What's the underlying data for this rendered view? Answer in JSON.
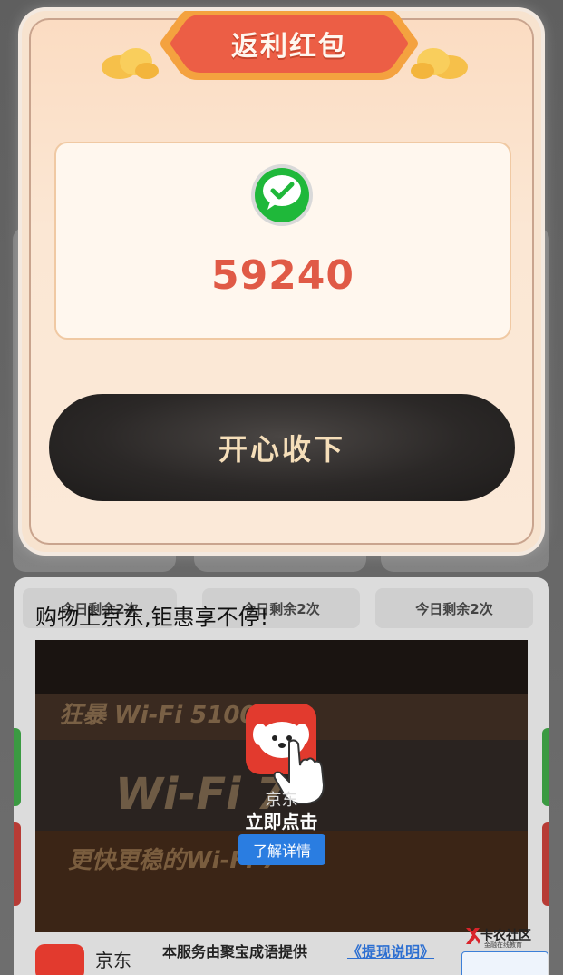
{
  "modal": {
    "title": "返利红包",
    "amount": "59240",
    "accept_label": "开心收下"
  },
  "ad": {
    "chips": [
      "今日剩余2次",
      "今日剩余2次",
      "今日剩余2次"
    ],
    "slogan": "购物上京东,钜惠享不停!",
    "video_text_1": "狂暴 Wi-Fi 5100M+",
    "video_text_2": "更快更稳的Wi-Fi 7",
    "video_text_3": "Wi-Fi 7",
    "app_name": "京东",
    "cta": "立即点击",
    "detail_label": "了解详情",
    "advertiser_name": "京东",
    "service_text": "本服务由聚宝成语提供",
    "service_link": "《提现说明》"
  },
  "watermark": {
    "text": "卡农社区",
    "sub": "金融在线教育"
  },
  "colors": {
    "amount": "#e05a46",
    "accent_red": "#e23a2e",
    "link_blue": "#2d6fd1",
    "wechat_green": "#1fb83a"
  },
  "icons": [
    "wechat-check-icon",
    "cloud-icon",
    "tap-hand-icon"
  ]
}
